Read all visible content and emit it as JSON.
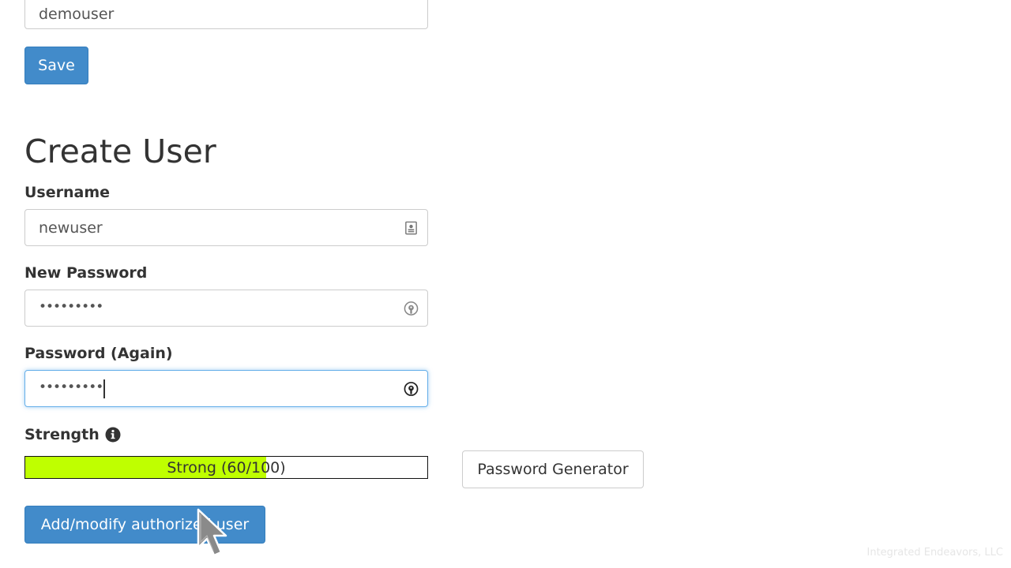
{
  "top_section": {
    "username_value": "demouser",
    "save_label": "Save"
  },
  "create_user": {
    "title": "Create User",
    "username_label": "Username",
    "username_value": "newuser",
    "new_password_label": "New Password",
    "new_password_value": "•••••••••",
    "password_again_label": "Password (Again)",
    "password_again_value": "•••••••••",
    "strength_label": "Strength",
    "strength_text": "Strong (60/100)",
    "strength_value": 60,
    "strength_max": 100,
    "password_generator_label": "Password Generator",
    "submit_label": "Add/modify authorized user"
  },
  "watermark": "Integrated Endeavors, LLC",
  "colors": {
    "primary": "#428bca",
    "strength_fill": "#bfff00",
    "focus_border": "#66afe9"
  },
  "icons": [
    "contact-card-icon",
    "password-key-icon",
    "info-circle-icon",
    "mouse-pointer-icon"
  ]
}
